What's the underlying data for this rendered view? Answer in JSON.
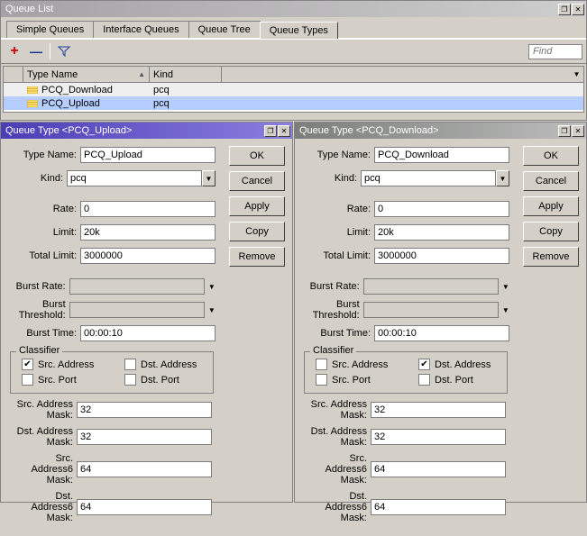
{
  "queue_list": {
    "title": "Queue List",
    "find_placeholder": "Find",
    "tabs": [
      {
        "label": "Simple Queues"
      },
      {
        "label": "Interface Queues"
      },
      {
        "label": "Queue Tree"
      },
      {
        "label": "Queue Types"
      }
    ],
    "columns": {
      "type_name": "Type Name",
      "kind": "Kind"
    },
    "rows": [
      {
        "type_name": "PCQ_Download",
        "kind": "pcq"
      },
      {
        "type_name": "PCQ_Upload",
        "kind": "pcq"
      }
    ],
    "sort_icon": "▲"
  },
  "buttons": {
    "ok": "OK",
    "cancel": "Cancel",
    "apply": "Apply",
    "copy": "Copy",
    "remove": "Remove"
  },
  "labels": {
    "type_name": "Type Name:",
    "kind": "Kind:",
    "rate": "Rate:",
    "limit": "Limit:",
    "total_limit": "Total Limit:",
    "burst_rate": "Burst Rate:",
    "burst_threshold": "Burst Threshold:",
    "burst_time": "Burst Time:",
    "classifier": "Classifier",
    "src_address": "Src. Address",
    "dst_address": "Dst. Address",
    "src_port": "Src. Port",
    "dst_port": "Dst. Port",
    "src_mask": "Src. Address Mask:",
    "dst_mask": "Dst. Address Mask:",
    "src6_mask": "Src. Address6 Mask:",
    "dst6_mask": "Dst. Address6 Mask:"
  },
  "upload": {
    "title": "Queue Type <PCQ_Upload>",
    "type_name": "PCQ_Upload",
    "kind": "pcq",
    "rate": "0",
    "limit": "20k",
    "total_limit": "3000000",
    "burst_rate": "",
    "burst_threshold": "",
    "burst_time": "00:00:10",
    "src_address": true,
    "dst_address": false,
    "src_port": false,
    "dst_port": false,
    "src_mask": "32",
    "dst_mask": "32",
    "src6_mask": "64",
    "dst6_mask": "64"
  },
  "download": {
    "title": "Queue Type <PCQ_Download>",
    "type_name": "PCQ_Download",
    "kind": "pcq",
    "rate": "0",
    "limit": "20k",
    "total_limit": "3000000",
    "burst_rate": "",
    "burst_threshold": "",
    "burst_time": "00:00:10",
    "src_address": false,
    "dst_address": true,
    "src_port": false,
    "dst_port": false,
    "src_mask": "32",
    "dst_mask": "32",
    "src6_mask": "64",
    "dst6_mask": "64"
  },
  "icons": {
    "plus": "＋",
    "minus": "━",
    "check": "✔",
    "down": "▼",
    "restore": "❐",
    "close": "✕",
    "tri": "▼"
  }
}
